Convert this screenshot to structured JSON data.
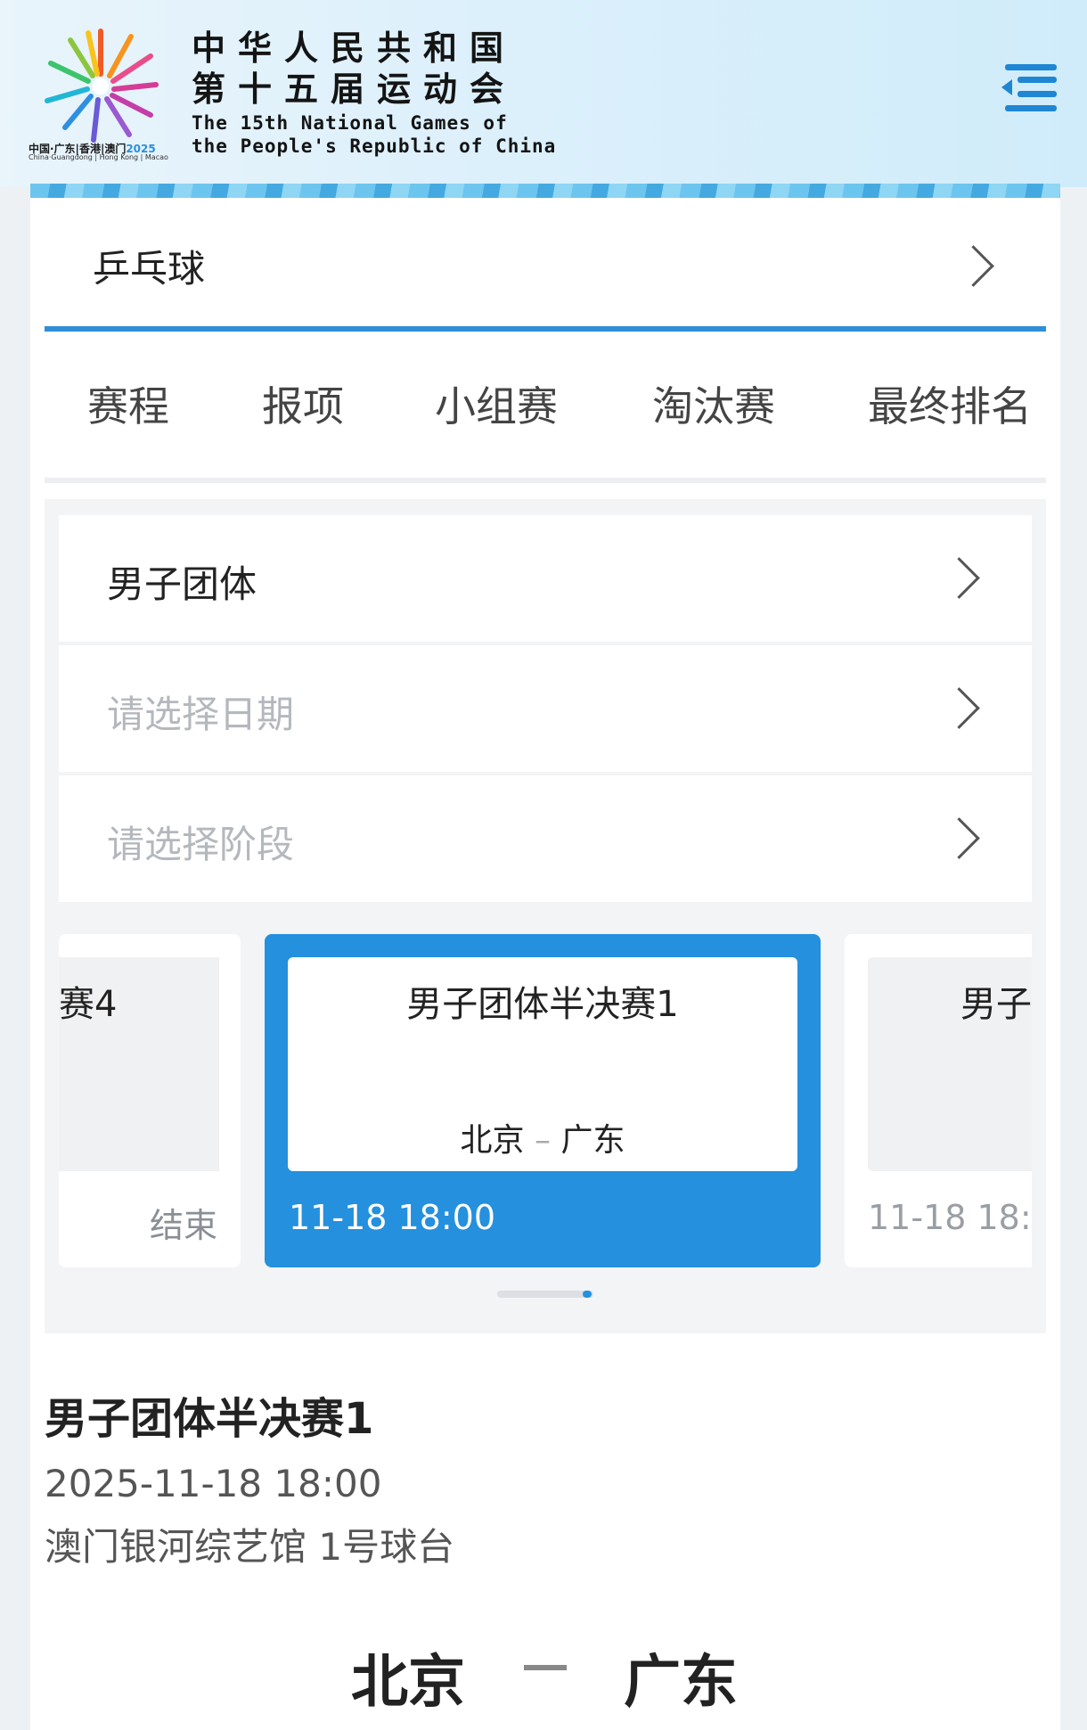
{
  "header": {
    "title_zh_line1": "中华人民共和国",
    "title_zh_line2": "第十五届运动会",
    "title_en_line1": "The 15th National Games of",
    "title_en_line2": "the People's Republic of China",
    "logo_caption": "中国·广东|香港|澳门",
    "logo_year": "2025",
    "logo_caption_en": "China·Guangdong | Hong Kong | Macao",
    "menu_icon": "menu-list-icon"
  },
  "sport": {
    "label": "乒乓球",
    "icon": "chevron-right-icon"
  },
  "tabs": [
    {
      "label": "赛程"
    },
    {
      "label": "报项"
    },
    {
      "label": "小组赛"
    },
    {
      "label": "淘汰赛"
    },
    {
      "label": "最终排名"
    }
  ],
  "filters": {
    "event": {
      "value": "男子团体"
    },
    "date": {
      "placeholder": "请选择日期"
    },
    "stage": {
      "placeholder": "请选择阶段"
    }
  },
  "carousel": {
    "prev": {
      "title": "赛4",
      "status": "结束"
    },
    "active": {
      "title": "男子团体半决赛1",
      "team_a": "北京",
      "separator": "–",
      "team_b": "广东",
      "time": "11-18  18:00"
    },
    "next": {
      "title": "男子",
      "time": "11-18  18:"
    }
  },
  "detail": {
    "title": "男子团体半决赛1",
    "datetime": "2025-11-18 18:00",
    "venue": "澳门银河综艺馆 1号球台",
    "team_a": "北京",
    "team_b": "广东"
  },
  "colors": {
    "accent": "#2590dd",
    "blue_line": "#2e8fd8",
    "placeholder": "#b4b8bd"
  }
}
